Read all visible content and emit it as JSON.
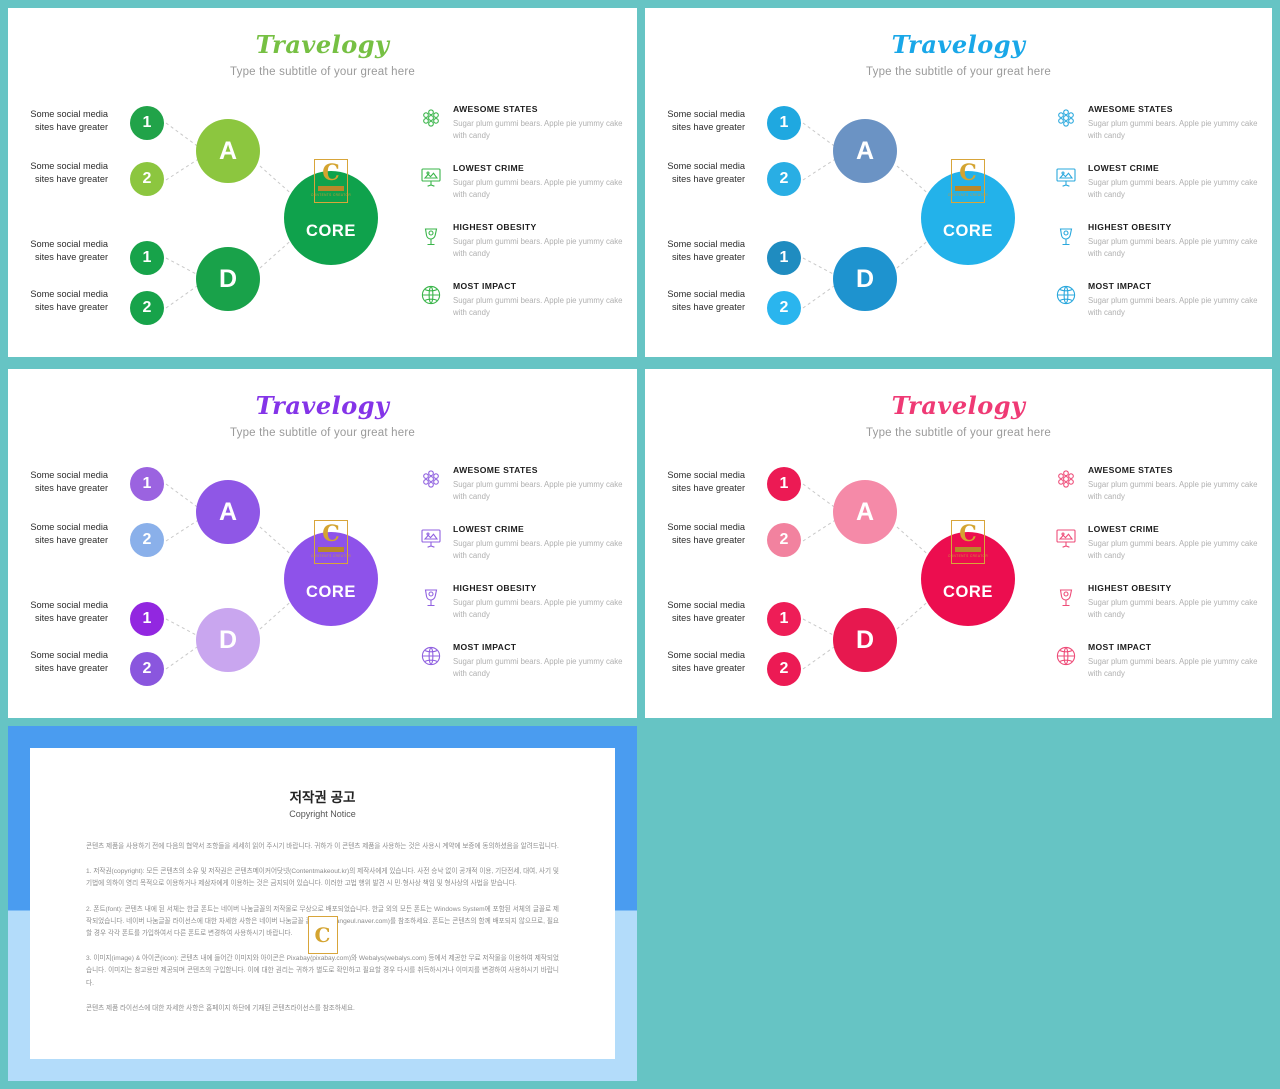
{
  "background_color": "#66c4c4",
  "slides": [
    {
      "id": "green",
      "title": "Travelogy",
      "subtitle": "Type the subtitle of your great here",
      "title_color": "#76c043",
      "colors": {
        "num1a": "#21a349",
        "num2a": "#8cc63f",
        "num1b": "#17a34a",
        "num2b": "#17a34a",
        "mid_a": "#8cc63f",
        "mid_d": "#19a24a",
        "core": "#0fa24c",
        "icon": "#3ab54a"
      },
      "nodes": [
        {
          "label": "Some social media sites have greater",
          "num": "1"
        },
        {
          "label": "Some social media sites have greater",
          "num": "2"
        },
        {
          "label": "Some social media sites have greater",
          "num": "1"
        },
        {
          "label": "Some social media sites have greater",
          "num": "2"
        }
      ],
      "mid_top": "A",
      "mid_bottom": "D",
      "core_label": "CORE",
      "legend": [
        {
          "icon": "atom-icon",
          "title": "AWESOME STATES",
          "desc": "Sugar plum gummi bears. Apple pie yummy cake with candy"
        },
        {
          "icon": "presentation-icon",
          "title": "LOWEST CRIME",
          "desc": "Sugar plum gummi bears. Apple pie yummy cake with candy"
        },
        {
          "icon": "lamp-icon",
          "title": "HIGHEST OBESITY",
          "desc": "Sugar plum gummi bears. Apple pie yummy cake with candy"
        },
        {
          "icon": "globe-icon",
          "title": "MOST IMPACT",
          "desc": "Sugar plum gummi bears. Apple pie yummy cake with candy"
        }
      ]
    },
    {
      "id": "blue",
      "title": "Travelogy",
      "subtitle": "Type the subtitle of your great here",
      "title_color": "#19a7e8",
      "colors": {
        "num1a": "#1fa8e0",
        "num2a": "#29aee4",
        "num1b": "#1f8cc0",
        "num2b": "#2ab5ee",
        "mid_a": "#6b93c4",
        "mid_d": "#1e93cf",
        "core": "#23b2ea",
        "icon": "#2aa8dd"
      },
      "nodes": [
        {
          "label": "Some social media sites have greater",
          "num": "1"
        },
        {
          "label": "Some social media sites have greater",
          "num": "2"
        },
        {
          "label": "Some social media sites have greater",
          "num": "1"
        },
        {
          "label": "Some social media sites have greater",
          "num": "2"
        }
      ],
      "mid_top": "A",
      "mid_bottom": "D",
      "core_label": "CORE",
      "legend": [
        {
          "icon": "atom-icon",
          "title": "AWESOME STATES",
          "desc": "Sugar plum gummi bears. Apple pie yummy cake with candy"
        },
        {
          "icon": "presentation-icon",
          "title": "LOWEST CRIME",
          "desc": "Sugar plum gummi bears. Apple pie yummy cake with candy"
        },
        {
          "icon": "lamp-icon",
          "title": "HIGHEST OBESITY",
          "desc": "Sugar plum gummi bears. Apple pie yummy cake with candy"
        },
        {
          "icon": "globe-icon",
          "title": "MOST IMPACT",
          "desc": "Sugar plum gummi bears. Apple pie yummy cake with candy"
        }
      ]
    },
    {
      "id": "purple",
      "title": "Travelogy",
      "subtitle": "Type the subtitle of your great here",
      "title_color": "#8434e8",
      "colors": {
        "num1a": "#9b63e0",
        "num2a": "#8ab0ea",
        "num1b": "#9227e0",
        "num2b": "#8a56de",
        "mid_a": "#8f57e6",
        "mid_d": "#c9a6ef",
        "core": "#8e52ea",
        "icon": "#9061e0"
      },
      "nodes": [
        {
          "label": "Some social media sites have greater",
          "num": "1"
        },
        {
          "label": "Some social media sites have greater",
          "num": "2"
        },
        {
          "label": "Some social media sites have greater",
          "num": "1"
        },
        {
          "label": "Some social media sites have greater",
          "num": "2"
        }
      ],
      "mid_top": "A",
      "mid_bottom": "D",
      "core_label": "CORE",
      "legend": [
        {
          "icon": "atom-icon",
          "title": "AWESOME STATES",
          "desc": "Sugar plum gummi bears. Apple pie yummy cake with candy"
        },
        {
          "icon": "presentation-icon",
          "title": "LOWEST CRIME",
          "desc": "Sugar plum gummi bears. Apple pie yummy cake with candy"
        },
        {
          "icon": "lamp-icon",
          "title": "HIGHEST OBESITY",
          "desc": "Sugar plum gummi bears. Apple pie yummy cake with candy"
        },
        {
          "icon": "globe-icon",
          "title": "MOST IMPACT",
          "desc": "Sugar plum gummi bears. Apple pie yummy cake with candy"
        }
      ]
    },
    {
      "id": "pink",
      "title": "Travelogy",
      "subtitle": "Type the subtitle of your great here",
      "title_color": "#ef3a75",
      "colors": {
        "num1a": "#ec1a54",
        "num2a": "#f2829f",
        "num1b": "#ee1d57",
        "num2b": "#ec1a54",
        "mid_a": "#f58aa8",
        "mid_d": "#e7184f",
        "core": "#ec0d4f",
        "icon": "#ee4d79"
      },
      "nodes": [
        {
          "label": "Some social media sites have greater",
          "num": "1"
        },
        {
          "label": "Some social media sites have greater",
          "num": "2"
        },
        {
          "label": "Some social media sites have greater",
          "num": "1"
        },
        {
          "label": "Some social media sites have greater",
          "num": "2"
        }
      ],
      "mid_top": "A",
      "mid_bottom": "D",
      "core_label": "CORE",
      "legend": [
        {
          "icon": "atom-icon",
          "title": "AWESOME STATES",
          "desc": "Sugar plum gummi bears. Apple pie yummy cake with candy"
        },
        {
          "icon": "presentation-icon",
          "title": "LOWEST CRIME",
          "desc": "Sugar plum gummi bears. Apple pie yummy cake with candy"
        },
        {
          "icon": "lamp-icon",
          "title": "HIGHEST OBESITY",
          "desc": "Sugar plum gummi bears. Apple pie yummy cake with candy"
        },
        {
          "icon": "globe-icon",
          "title": "MOST IMPACT",
          "desc": "Sugar plum gummi bears. Apple pie yummy cake with candy"
        }
      ]
    }
  ],
  "logo": {
    "letter": "C",
    "sub": "CONTENTS CREATOR",
    "border_color": "#d8a53a",
    "letter_color": "#d4a430"
  },
  "copyright": {
    "frame_color_top": "#4a9cf0",
    "frame_color_bottom": "#b3dcfa",
    "title": "저작권 공고",
    "subtitle": "Copyright Notice",
    "paragraphs": [
      "콘텐츠 제품을 사용하기 전에 다음의 협약서 조항들을 세세히 읽어 주시기 바랍니다. 귀하가 이 콘텐츠 제품을 사용하는 것은 사용시 계약에 보증에 동의하셨음을 알려드립니다.",
      "1. 저작권(copyright): 모든 콘텐츠의 소유 및 저작권은 콘텐츠메이커어닷넷(Contentmakeout.kr)의 제작사에게 있습니다. 사전 승낙 없이 공개적 이용, 기단전세, 대여, 사기 및 기법에 의하이 영리 목적으로 이용하거나 제삼자에게 이용하는 것은 금지되어 있습니다. 이러한 고법 행위 발견 시 민·형사상 책임 및 형사상의 사법을 받습니다.",
      "2. 폰트(font): 콘텐츠 내에 된 서체는 한글 폰트는 네이버 나눔글꼴의 저작물로 무상으로 배포되었습니다. 한글 외의 모든 폰트는 Windows System에 포함된 서체의 글꼴로 제작되었습니다. 네이버 나눔글꼴 라이선스에 대한 자세한 사항은 네이버 나눔글꼴 홈페이지(hangeul.naver.com)를 참조하세요. 폰트는 콘텐츠의 함께 배포되지 않으므로, 필요할 경우 각각 폰트를 가입하여서 다른 폰트로 변경하여 사용하시기 바랍니다.",
      "3. 이미지(image) & 아이콘(icon): 콘텐츠 내에 들어간 이미지와 아이콘은 Pixabay(pixabay.com)와 Webalys(webalys.com) 등에서 제공한 무료 저작물을 이용하여 제작되었습니다. 이미지는 참고용만 제공되며 콘텐츠의 구입함니다. 이에 대한 권리는 귀하가 별도로 확인하고 필요할 경우 다시를 취득하시거나 이미지를 변경하여 사용하시기 바랍니다.",
      "콘텐츠 제품 라이선스에 대한 자세한 사항은 홈페이지 하단에 기재된 콘텐츠라이선스를 참조하세요."
    ]
  }
}
